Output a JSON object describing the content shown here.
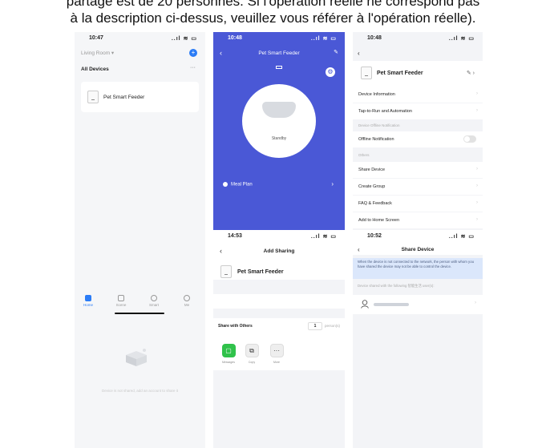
{
  "caption": {
    "line1": "partage est de 20 personnes. Si l'opération réelle ne correspond pas",
    "line2": "à la description ci-dessus, veuillez vous référer à l'opération réelle)."
  },
  "screen1": {
    "time": "10:47",
    "signal": "..ıl ≋ ▭",
    "room": "Living Room ▾",
    "plus": "+",
    "all_devices": "All Devices",
    "more": "···",
    "device_name": "Pet Smart Feeder",
    "tabs": [
      {
        "label": "Home",
        "icon": "home-icon",
        "active": true
      },
      {
        "label": "Scene",
        "icon": "scene-icon"
      },
      {
        "label": "Smart",
        "icon": "smart-icon"
      },
      {
        "label": "Me",
        "icon": "me-icon"
      }
    ],
    "empty_text": "Device is not shared, add an account to share it"
  },
  "screen2": {
    "time": "10:48",
    "signal": "..ıl ≋ ▭",
    "back": "‹",
    "title": "Pet Smart Feeder",
    "edit": "✎",
    "gear": "⚙",
    "status": "Standby",
    "meal_plan": "Meal Plan",
    "chevron": "›",
    "accent_color": "#4a58d6"
  },
  "screen3": {
    "time": "10:48",
    "signal": "..ıl ≋ ▭",
    "back": "‹",
    "device_name": "Pet Smart Feeder",
    "edit": "✎ ›",
    "rows": [
      {
        "label": "Device Information"
      },
      {
        "label": "Tap-to-Run and Automation"
      }
    ],
    "section_offline": "Device Offline Notification",
    "offline_label": "Offline Notification",
    "section_others": "Others",
    "others_rows": [
      {
        "label": "Share Device"
      },
      {
        "label": "Create Group"
      },
      {
        "label": "FAQ & Feedback"
      },
      {
        "label": "Add to Home Screen"
      }
    ],
    "chevron": "›"
  },
  "screen4": {
    "time": "14:53",
    "signal": "..ıl ≋ ▭",
    "back": "‹",
    "title": "Add Sharing",
    "device_name": "Pet Smart Feeder",
    "share_with_others": "Share with Others",
    "count": "1",
    "unit": "person(s)",
    "share_options": [
      {
        "label": "Messages",
        "icon": "messages-icon",
        "glyph": "▢"
      },
      {
        "label": "Copy",
        "icon": "copy-icon",
        "glyph": "⧉"
      },
      {
        "label": "More",
        "icon": "more-icon",
        "glyph": "···"
      }
    ]
  },
  "screen5": {
    "time": "10:52",
    "signal": "..ıl ≋ ▭",
    "back": "‹",
    "title": "Share Device",
    "notice": "When the device is not connected to the network, the person with whom you have shared the device may not be able to control the device.",
    "shared_with": "Device shared with the following 智能生活 user(s):",
    "chevron": "›"
  }
}
